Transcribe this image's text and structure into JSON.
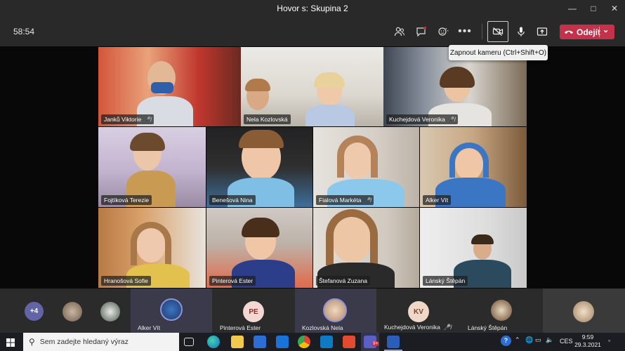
{
  "window": {
    "title": "Hovor s: Skupina 2"
  },
  "toolbar": {
    "timer": "58:54",
    "leave_label": "Odejít",
    "tooltip": "Zapnout kameru (Ctrl+Shift+O)"
  },
  "participants": [
    {
      "name": "Janků Viktorie",
      "muted": true
    },
    {
      "name": "Nela Kozlovská",
      "muted": false
    },
    {
      "name": "Kuchejdová Veronika",
      "muted": true
    },
    {
      "name": "Fojtíková Terezie",
      "muted": false
    },
    {
      "name": "Benešová Nina",
      "muted": false
    },
    {
      "name": "Fialová Markéta",
      "muted": true
    },
    {
      "name": "Alker Vít",
      "muted": false
    },
    {
      "name": "Hranošová Sofie",
      "muted": false
    },
    {
      "name": "Pinterová Ester",
      "muted": false
    },
    {
      "name": "Štefanová Zuzana",
      "muted": false
    },
    {
      "name": "Lánský Štěpán",
      "muted": false
    }
  ],
  "roster": {
    "overflow": "+4",
    "people": [
      {
        "name": "Alker Vít",
        "initials": "",
        "muted": false
      },
      {
        "name": "Pinterová Ester",
        "initials": "PE",
        "muted": false
      },
      {
        "name": "Kozlovská Nela",
        "initials": "",
        "muted": false
      },
      {
        "name": "Kuchejdová Veronika",
        "initials": "KV",
        "muted": true
      },
      {
        "name": "Lánský Štěpán",
        "initials": "",
        "muted": false
      }
    ]
  },
  "taskbar": {
    "search_placeholder": "Sem zadejte hledaný výraz",
    "language": "CES",
    "time": "9:59",
    "date": "29.3.2021",
    "teams_badge": "9+"
  },
  "colors": {
    "leave": "#c4314b",
    "accent_purple": "#6264a7"
  }
}
